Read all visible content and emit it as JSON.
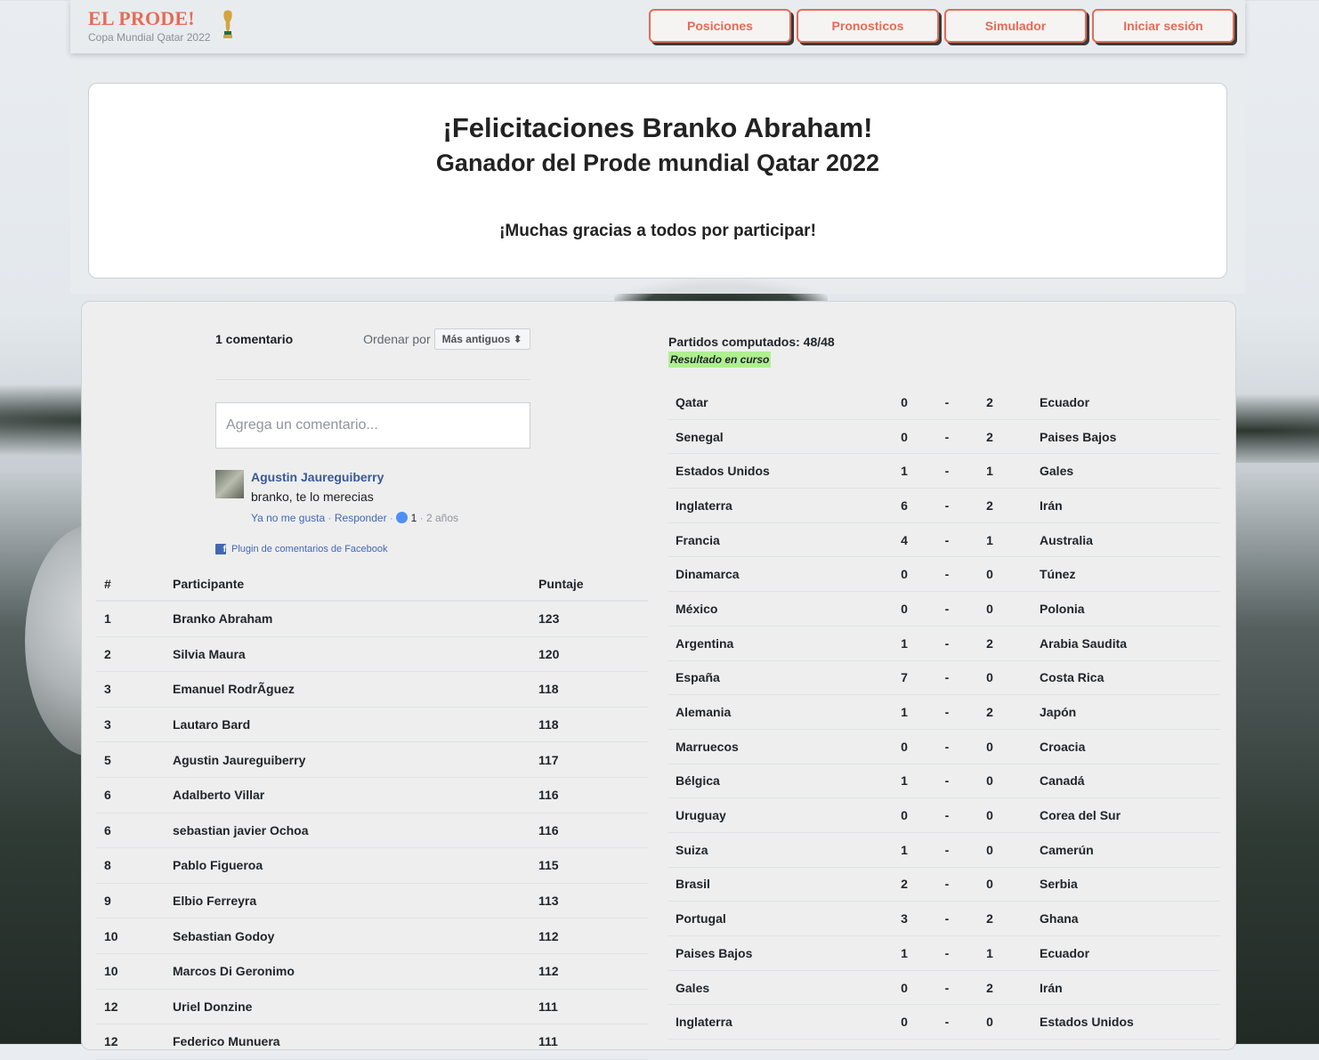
{
  "brand": {
    "title": "EL PRODE!",
    "subtitle": "Copa Mundial Qatar 2022"
  },
  "nav": [
    "Posiciones",
    "Pronosticos",
    "Simulador",
    "Iniciar sesión"
  ],
  "hero": {
    "title": "¡Felicitaciones Branko Abraham!",
    "subtitle": "Ganador del Prode mundial Qatar 2022",
    "thanks": "¡Muchas gracias a todos por participar!"
  },
  "comments": {
    "count": "1 comentario",
    "order_label": "Ordenar por",
    "order_value": "Más antiguos",
    "placeholder": "Agrega un comentario...",
    "author": "Agustin Jaureguiberry",
    "text": "branko, te lo merecias",
    "unlike": "Ya no me gusta",
    "reply": "Responder",
    "likes": "1",
    "age": "2 años",
    "plugin": "Plugin de comentarios de Facebook"
  },
  "ranking": {
    "headers": [
      "#",
      "Participante",
      "Puntaje"
    ],
    "rows": [
      [
        "1",
        "Branko Abraham",
        "123"
      ],
      [
        "2",
        "Silvia Maura",
        "120"
      ],
      [
        "3",
        "Emanuel RodrÃguez",
        "118"
      ],
      [
        "3",
        "Lautaro Bard",
        "118"
      ],
      [
        "5",
        "Agustin Jaureguiberry",
        "117"
      ],
      [
        "6",
        "Adalberto Villar",
        "116"
      ],
      [
        "6",
        "sebastian javier Ochoa",
        "116"
      ],
      [
        "8",
        "Pablo Figueroa",
        "115"
      ],
      [
        "9",
        "Elbio Ferreyra",
        "113"
      ],
      [
        "10",
        "Sebastian Godoy",
        "112"
      ],
      [
        "10",
        "Marcos Di Geronimo",
        "112"
      ],
      [
        "12",
        "Uriel Donzine",
        "111"
      ],
      [
        "12",
        "Federico Munuera",
        "111"
      ]
    ]
  },
  "matches": {
    "computed": "Partidos computados: 48/48",
    "status": "Resultado en curso",
    "rows": [
      [
        "Qatar",
        "0",
        "-",
        "2",
        "Ecuador"
      ],
      [
        "Senegal",
        "0",
        "-",
        "2",
        "Paises Bajos"
      ],
      [
        "Estados Unidos",
        "1",
        "-",
        "1",
        "Gales"
      ],
      [
        "Inglaterra",
        "6",
        "-",
        "2",
        "Irán"
      ],
      [
        "Francia",
        "4",
        "-",
        "1",
        "Australia"
      ],
      [
        "Dinamarca",
        "0",
        "-",
        "0",
        "Túnez"
      ],
      [
        "México",
        "0",
        "-",
        "0",
        "Polonia"
      ],
      [
        "Argentina",
        "1",
        "-",
        "2",
        "Arabia Saudita"
      ],
      [
        "España",
        "7",
        "-",
        "0",
        "Costa Rica"
      ],
      [
        "Alemania",
        "1",
        "-",
        "2",
        "Japón"
      ],
      [
        "Marruecos",
        "0",
        "-",
        "0",
        "Croacia"
      ],
      [
        "Bélgica",
        "1",
        "-",
        "0",
        "Canadá"
      ],
      [
        "Uruguay",
        "0",
        "-",
        "0",
        "Corea del Sur"
      ],
      [
        "Suiza",
        "1",
        "-",
        "0",
        "Camerún"
      ],
      [
        "Brasil",
        "2",
        "-",
        "0",
        "Serbia"
      ],
      [
        "Portugal",
        "3",
        "-",
        "2",
        "Ghana"
      ],
      [
        "Paises Bajos",
        "1",
        "-",
        "1",
        "Ecuador"
      ],
      [
        "Gales",
        "0",
        "-",
        "2",
        "Irán"
      ],
      [
        "Inglaterra",
        "0",
        "-",
        "0",
        "Estados Unidos"
      ]
    ]
  }
}
